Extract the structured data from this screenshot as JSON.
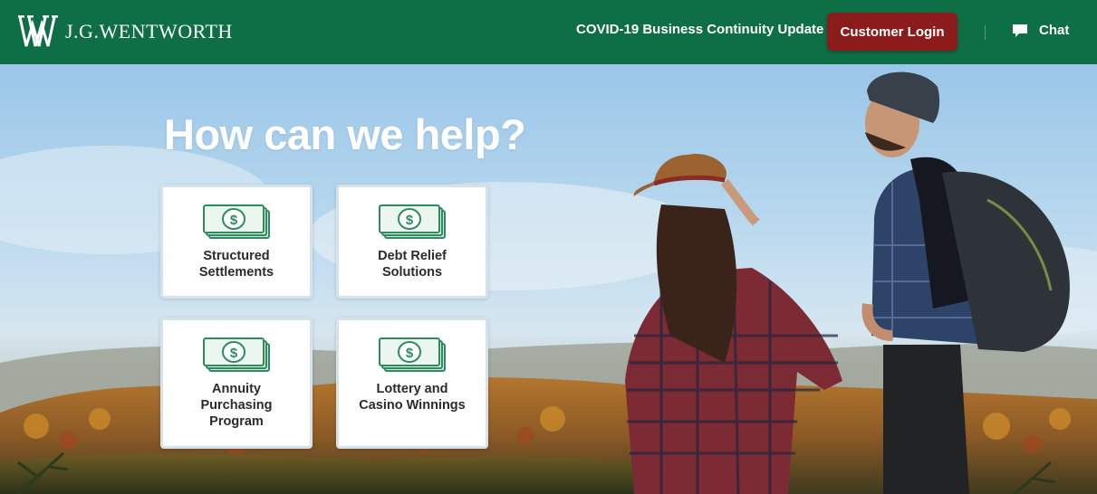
{
  "header": {
    "logo_text": "J.G.WENTWORTH",
    "covid_link": "COVID-19 Business Continuity Update",
    "login_button": "Customer Login",
    "chat_label": "Chat"
  },
  "hero": {
    "title": "How can we help?",
    "cards": [
      {
        "label": "Structured Settlements",
        "icon": "money-icon"
      },
      {
        "label": "Debt Relief Solutions",
        "icon": "money-icon"
      },
      {
        "label": "Annuity Purchasing Program",
        "icon": "money-icon"
      },
      {
        "label": "Lottery and Casino Winnings",
        "icon": "money-icon"
      }
    ]
  },
  "colors": {
    "brand_green": "#0e6e45",
    "login_red": "#8c1c1c",
    "money_green": "#2f8a5f"
  }
}
